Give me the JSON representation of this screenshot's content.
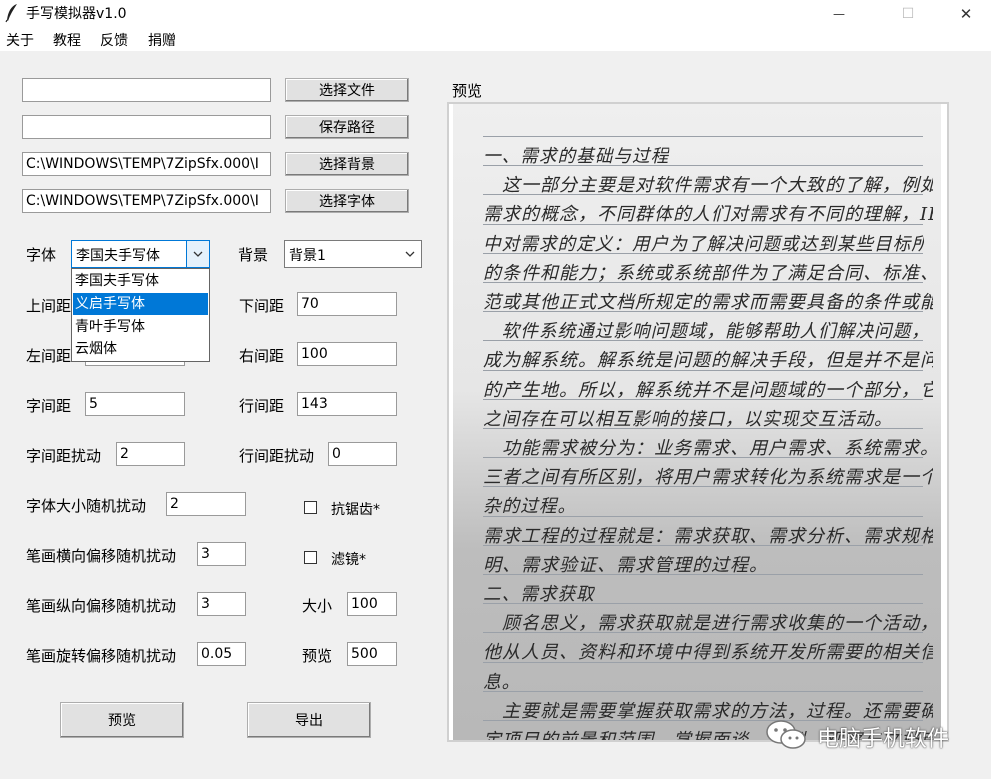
{
  "window": {
    "title": "手写模拟器v1.0",
    "minimize": "—",
    "maximize": "☐",
    "close": "✕"
  },
  "menu": [
    "关于",
    "教程",
    "反馈",
    "捐赠"
  ],
  "file_rows": [
    {
      "value": "",
      "button": "选择文件"
    },
    {
      "value": "",
      "button": "保存路径"
    },
    {
      "value": "C:\\WINDOWS\\TEMP\\7ZipSfx.000\\I",
      "button": "选择背景"
    },
    {
      "value": "C:\\WINDOWS\\TEMP\\7ZipSfx.000\\I",
      "button": "选择字体"
    }
  ],
  "font": {
    "label": "字体",
    "value": "李国夫手写体",
    "options": [
      "李国夫手写体",
      "义启手写体",
      "青叶手写体",
      "云烟体"
    ],
    "highlighted": "义启手写体"
  },
  "background": {
    "label": "背景",
    "value": "背景1"
  },
  "fields": {
    "top_margin": {
      "label": "上间距",
      "value": ""
    },
    "bottom_margin": {
      "label": "下间距",
      "value": "70"
    },
    "left_margin": {
      "label": "左间距",
      "value": ""
    },
    "right_margin": {
      "label": "右间距",
      "value": "100"
    },
    "char_spacing": {
      "label": "字间距",
      "value": "5"
    },
    "line_spacing": {
      "label": "行间距",
      "value": "143"
    },
    "char_spacing_jitter": {
      "label": "字间距扰动",
      "value": "2"
    },
    "line_spacing_jitter": {
      "label": "行间距扰动",
      "value": "0"
    },
    "font_size_jitter": {
      "label": "字体大小随机扰动",
      "value": "2"
    },
    "stroke_h_jitter": {
      "label": "笔画横向偏移随机扰动",
      "value": "3"
    },
    "stroke_v_jitter": {
      "label": "笔画纵向偏移随机扰动",
      "value": "3"
    },
    "stroke_rot_jitter": {
      "label": "笔画旋转偏移随机扰动",
      "value": "0.05"
    },
    "size": {
      "label": "大小",
      "value": "100"
    },
    "preview_size": {
      "label": "预览",
      "value": "500"
    }
  },
  "checkboxes": {
    "antialias": "抗锯齿*",
    "filter": "滤镜*"
  },
  "buttons": {
    "preview": "预览",
    "export": "导出"
  },
  "preview_panel": {
    "label": "预览",
    "lines": [
      "一、需求的基础与过程",
      "　这一部分主要是对软件需求有一个大致的了解，例如",
      "需求的概念，不同群体的人们对需求有不同的理解，IEEE",
      "中对需求的定义：用户为了解决问题或达到某些目标所需要",
      "的条件和能力；系统或系统部件为了满足合同、标准、规",
      "范或其他正式文档所规定的需求而需要具备的条件或能力。",
      "　软件系统通过影响问题域，能够帮助人们解决问题，",
      "成为解系统。解系统是问题的解决手段，但是并不是问题",
      "的产生地。所以，解系统并不是问题域的一个部分，它们",
      "之间存在可以相互影响的接口，以实现交互活动。",
      "　功能需求被分为：业务需求、用户需求、系统需求。",
      "三者之间有所区别，将用户需求转化为系统需求是一个复",
      "杂的过程。",
      "需求工程的过程就是：需求获取、需求分析、需求规格说",
      "明、需求验证、需求管理的过程。",
      "二、需求获取",
      "　顾名思义，需求获取就是进行需求收集的一个活动，",
      "他从人员、资料和环境中得到系统开发所需要的相关信",
      "息。",
      "　主要就是需要掌握获取需求的方法，过程。还需要确",
      "定项目的前景和范围，掌握面谈、原型、观察与文档审查"
    ]
  },
  "watermark": "电脑手机软件"
}
